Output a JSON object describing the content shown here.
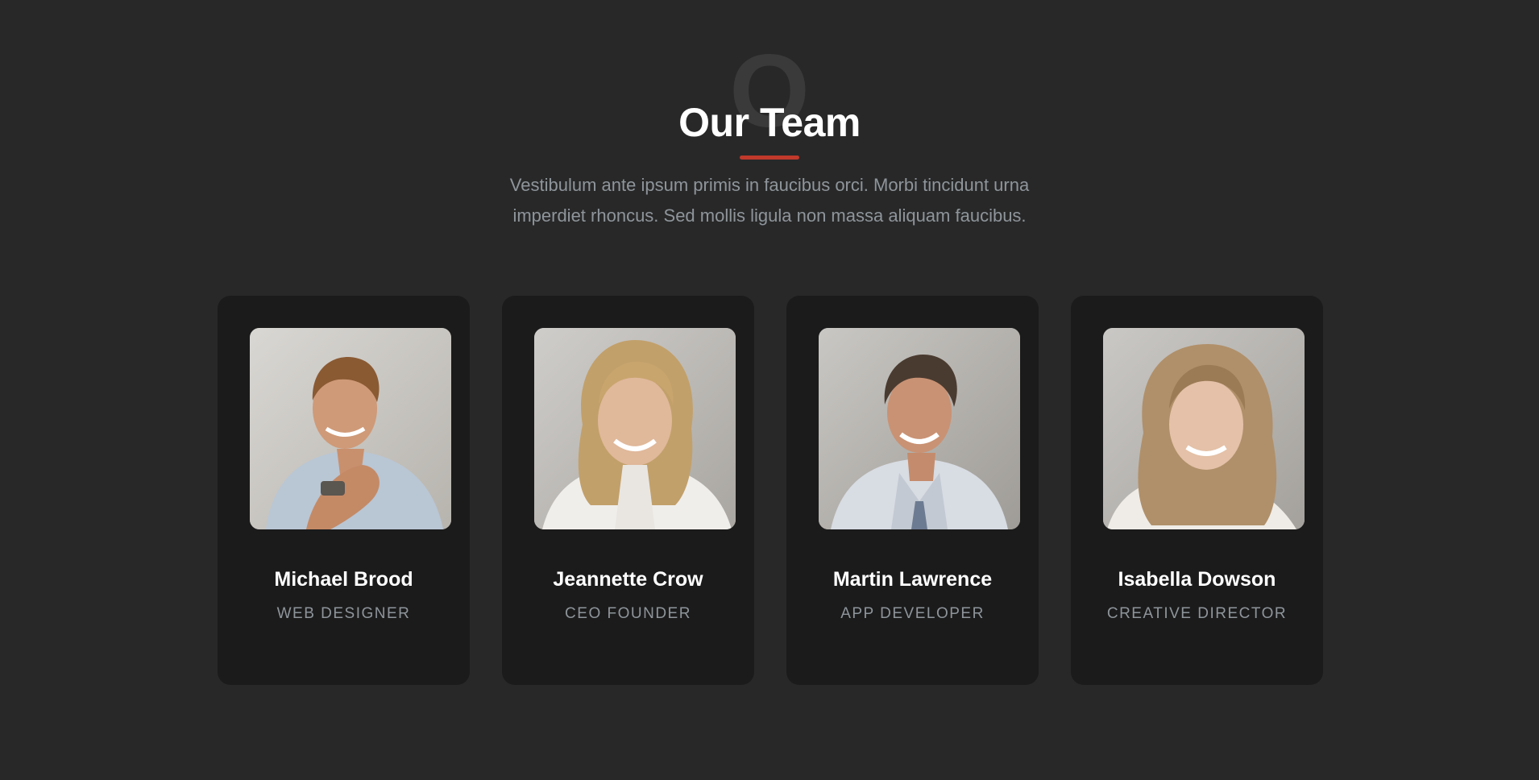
{
  "section": {
    "background_letter": "O",
    "title": "Our Team",
    "subtitle": "Vestibulum ante ipsum primis in faucibus orci. Morbi tincidunt urna imperdiet rhoncus. Sed mollis ligula non massa aliquam faucibus.",
    "accent_color": "#c0392b"
  },
  "team": [
    {
      "name": "Michael Brood",
      "role": "WEB DESIGNER",
      "photo_icon": "man-portrait"
    },
    {
      "name": "Jeannette Crow",
      "role": "CEO FOUNDER",
      "photo_icon": "woman-portrait"
    },
    {
      "name": "Martin Lawrence",
      "role": "APP DEVELOPER",
      "photo_icon": "man-portrait"
    },
    {
      "name": "Isabella Dowson",
      "role": "CREATIVE DIRECTOR",
      "photo_icon": "woman-portrait"
    }
  ]
}
